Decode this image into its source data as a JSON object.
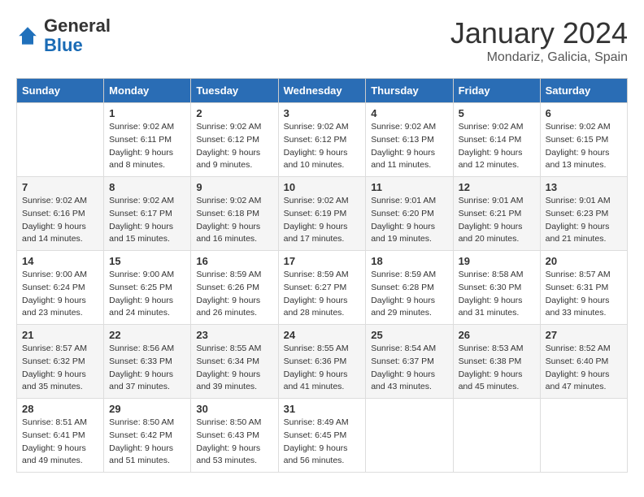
{
  "header": {
    "logo": {
      "general": "General",
      "blue": "Blue"
    },
    "title": "January 2024",
    "location": "Mondariz, Galicia, Spain"
  },
  "calendar": {
    "columns": [
      "Sunday",
      "Monday",
      "Tuesday",
      "Wednesday",
      "Thursday",
      "Friday",
      "Saturday"
    ],
    "weeks": [
      [
        {
          "day": "",
          "sunrise": "",
          "sunset": "",
          "daylight": ""
        },
        {
          "day": "1",
          "sunrise": "Sunrise: 9:02 AM",
          "sunset": "Sunset: 6:11 PM",
          "daylight": "Daylight: 9 hours and 8 minutes."
        },
        {
          "day": "2",
          "sunrise": "Sunrise: 9:02 AM",
          "sunset": "Sunset: 6:12 PM",
          "daylight": "Daylight: 9 hours and 9 minutes."
        },
        {
          "day": "3",
          "sunrise": "Sunrise: 9:02 AM",
          "sunset": "Sunset: 6:12 PM",
          "daylight": "Daylight: 9 hours and 10 minutes."
        },
        {
          "day": "4",
          "sunrise": "Sunrise: 9:02 AM",
          "sunset": "Sunset: 6:13 PM",
          "daylight": "Daylight: 9 hours and 11 minutes."
        },
        {
          "day": "5",
          "sunrise": "Sunrise: 9:02 AM",
          "sunset": "Sunset: 6:14 PM",
          "daylight": "Daylight: 9 hours and 12 minutes."
        },
        {
          "day": "6",
          "sunrise": "Sunrise: 9:02 AM",
          "sunset": "Sunset: 6:15 PM",
          "daylight": "Daylight: 9 hours and 13 minutes."
        }
      ],
      [
        {
          "day": "7",
          "sunrise": "Sunrise: 9:02 AM",
          "sunset": "Sunset: 6:16 PM",
          "daylight": "Daylight: 9 hours and 14 minutes."
        },
        {
          "day": "8",
          "sunrise": "Sunrise: 9:02 AM",
          "sunset": "Sunset: 6:17 PM",
          "daylight": "Daylight: 9 hours and 15 minutes."
        },
        {
          "day": "9",
          "sunrise": "Sunrise: 9:02 AM",
          "sunset": "Sunset: 6:18 PM",
          "daylight": "Daylight: 9 hours and 16 minutes."
        },
        {
          "day": "10",
          "sunrise": "Sunrise: 9:02 AM",
          "sunset": "Sunset: 6:19 PM",
          "daylight": "Daylight: 9 hours and 17 minutes."
        },
        {
          "day": "11",
          "sunrise": "Sunrise: 9:01 AM",
          "sunset": "Sunset: 6:20 PM",
          "daylight": "Daylight: 9 hours and 19 minutes."
        },
        {
          "day": "12",
          "sunrise": "Sunrise: 9:01 AM",
          "sunset": "Sunset: 6:21 PM",
          "daylight": "Daylight: 9 hours and 20 minutes."
        },
        {
          "day": "13",
          "sunrise": "Sunrise: 9:01 AM",
          "sunset": "Sunset: 6:23 PM",
          "daylight": "Daylight: 9 hours and 21 minutes."
        }
      ],
      [
        {
          "day": "14",
          "sunrise": "Sunrise: 9:00 AM",
          "sunset": "Sunset: 6:24 PM",
          "daylight": "Daylight: 9 hours and 23 minutes."
        },
        {
          "day": "15",
          "sunrise": "Sunrise: 9:00 AM",
          "sunset": "Sunset: 6:25 PM",
          "daylight": "Daylight: 9 hours and 24 minutes."
        },
        {
          "day": "16",
          "sunrise": "Sunrise: 8:59 AM",
          "sunset": "Sunset: 6:26 PM",
          "daylight": "Daylight: 9 hours and 26 minutes."
        },
        {
          "day": "17",
          "sunrise": "Sunrise: 8:59 AM",
          "sunset": "Sunset: 6:27 PM",
          "daylight": "Daylight: 9 hours and 28 minutes."
        },
        {
          "day": "18",
          "sunrise": "Sunrise: 8:59 AM",
          "sunset": "Sunset: 6:28 PM",
          "daylight": "Daylight: 9 hours and 29 minutes."
        },
        {
          "day": "19",
          "sunrise": "Sunrise: 8:58 AM",
          "sunset": "Sunset: 6:30 PM",
          "daylight": "Daylight: 9 hours and 31 minutes."
        },
        {
          "day": "20",
          "sunrise": "Sunrise: 8:57 AM",
          "sunset": "Sunset: 6:31 PM",
          "daylight": "Daylight: 9 hours and 33 minutes."
        }
      ],
      [
        {
          "day": "21",
          "sunrise": "Sunrise: 8:57 AM",
          "sunset": "Sunset: 6:32 PM",
          "daylight": "Daylight: 9 hours and 35 minutes."
        },
        {
          "day": "22",
          "sunrise": "Sunrise: 8:56 AM",
          "sunset": "Sunset: 6:33 PM",
          "daylight": "Daylight: 9 hours and 37 minutes."
        },
        {
          "day": "23",
          "sunrise": "Sunrise: 8:55 AM",
          "sunset": "Sunset: 6:34 PM",
          "daylight": "Daylight: 9 hours and 39 minutes."
        },
        {
          "day": "24",
          "sunrise": "Sunrise: 8:55 AM",
          "sunset": "Sunset: 6:36 PM",
          "daylight": "Daylight: 9 hours and 41 minutes."
        },
        {
          "day": "25",
          "sunrise": "Sunrise: 8:54 AM",
          "sunset": "Sunset: 6:37 PM",
          "daylight": "Daylight: 9 hours and 43 minutes."
        },
        {
          "day": "26",
          "sunrise": "Sunrise: 8:53 AM",
          "sunset": "Sunset: 6:38 PM",
          "daylight": "Daylight: 9 hours and 45 minutes."
        },
        {
          "day": "27",
          "sunrise": "Sunrise: 8:52 AM",
          "sunset": "Sunset: 6:40 PM",
          "daylight": "Daylight: 9 hours and 47 minutes."
        }
      ],
      [
        {
          "day": "28",
          "sunrise": "Sunrise: 8:51 AM",
          "sunset": "Sunset: 6:41 PM",
          "daylight": "Daylight: 9 hours and 49 minutes."
        },
        {
          "day": "29",
          "sunrise": "Sunrise: 8:50 AM",
          "sunset": "Sunset: 6:42 PM",
          "daylight": "Daylight: 9 hours and 51 minutes."
        },
        {
          "day": "30",
          "sunrise": "Sunrise: 8:50 AM",
          "sunset": "Sunset: 6:43 PM",
          "daylight": "Daylight: 9 hours and 53 minutes."
        },
        {
          "day": "31",
          "sunrise": "Sunrise: 8:49 AM",
          "sunset": "Sunset: 6:45 PM",
          "daylight": "Daylight: 9 hours and 56 minutes."
        },
        {
          "day": "",
          "sunrise": "",
          "sunset": "",
          "daylight": ""
        },
        {
          "day": "",
          "sunrise": "",
          "sunset": "",
          "daylight": ""
        },
        {
          "day": "",
          "sunrise": "",
          "sunset": "",
          "daylight": ""
        }
      ]
    ]
  }
}
